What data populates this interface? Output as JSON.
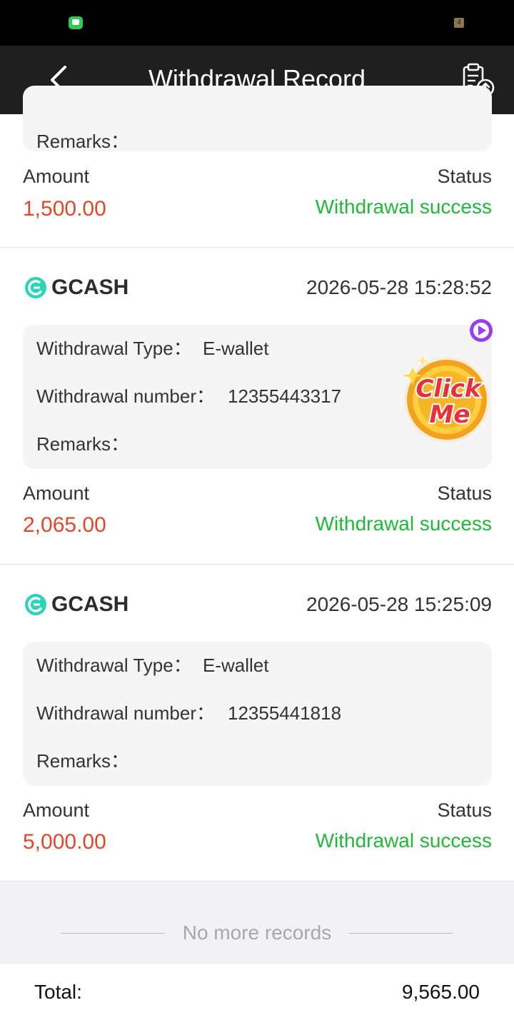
{
  "status_bar": {
    "badge": "4"
  },
  "header": {
    "title": "Withdrawal Record"
  },
  "labels": {
    "withdrawal_type": "Withdrawal Type：",
    "withdrawal_number": "Withdrawal number：",
    "remarks": "Remarks：",
    "amount": "Amount",
    "status": "Status"
  },
  "records": [
    {
      "remarks": "",
      "amount": "1,500.00",
      "status": "Withdrawal success"
    },
    {
      "brand": "GCASH",
      "datetime": "2026-05-28 15:28:52",
      "type": "E-wallet",
      "number": "12355443317",
      "remarks": "",
      "amount": "2,065.00",
      "status": "Withdrawal success"
    },
    {
      "brand": "GCASH",
      "datetime": "2026-05-28 15:25:09",
      "type": "E-wallet",
      "number": "12355441818",
      "remarks": "",
      "amount": "5,000.00",
      "status": "Withdrawal success"
    }
  ],
  "promo": {
    "line1": "Click",
    "line2": "Me"
  },
  "footer": {
    "no_more": "No more records",
    "total_label": "Total:",
    "total_value": "9,565.00"
  },
  "icons": {
    "back": "chevron-left-icon",
    "export": "clipboard-upload-icon",
    "brand_logo": "gcash-logo-icon",
    "promo_play": "play-icon"
  },
  "colors": {
    "header_bg": "#1f1f1f",
    "amount": "#e2472b",
    "status_success": "#1fb93a",
    "gcash_brand": "#2ad4b8"
  }
}
